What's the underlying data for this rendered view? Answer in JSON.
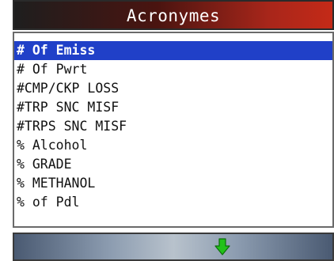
{
  "header": {
    "title": "Acronymes"
  },
  "list": {
    "items": [
      {
        "label": "# Of Emiss",
        "selected": true
      },
      {
        "label": "# Of Pwrt",
        "selected": false
      },
      {
        "label": "#CMP/CKP LOSS",
        "selected": false
      },
      {
        "label": "#TRP SNC MISF",
        "selected": false
      },
      {
        "label": "#TRPS SNC MISF",
        "selected": false
      },
      {
        "label": "% Alcohol",
        "selected": false
      },
      {
        "label": "% GRADE",
        "selected": false
      },
      {
        "label": "% METHANOL",
        "selected": false
      },
      {
        "label": "% of Pdl",
        "selected": false
      }
    ]
  },
  "footer": {
    "icon": "arrow-down-icon",
    "icon_color": "#22c21a"
  },
  "colors": {
    "selection": "#2040c8",
    "title_gradient_end": "#c42a18"
  }
}
